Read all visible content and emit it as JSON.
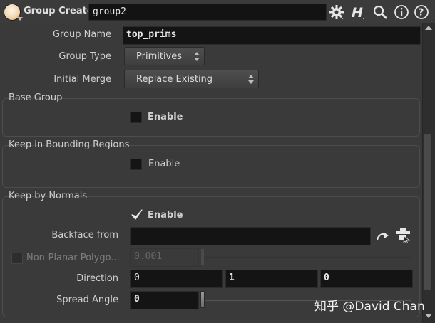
{
  "header": {
    "node_type": "Group Create",
    "node_name": "group2",
    "icons": [
      "node-type-icon",
      "gear-icon",
      "help-h-icon",
      "search-icon",
      "info-icon",
      "help-icon"
    ]
  },
  "params": {
    "group_name": {
      "label": "Group Name",
      "value": "top_prims"
    },
    "group_type": {
      "label": "Group Type",
      "value": "Primitives"
    },
    "initial_merge": {
      "label": "Initial Merge",
      "value": "Replace Existing"
    }
  },
  "base_group": {
    "title": "Base Group",
    "enable_label": "Enable",
    "enabled": false
  },
  "keep_bounding": {
    "title": "Keep in Bounding Regions",
    "enable_label": "Enable",
    "enabled": false
  },
  "keep_normals": {
    "title": "Keep by Normals",
    "enable_label": "Enable",
    "enabled": true,
    "backface_label": "Backface from",
    "backface_value": "",
    "nonplanar_label": "Non-Planar Polygo...",
    "nonplanar_value": "0.001",
    "direction_label": "Direction",
    "direction": [
      "0",
      "1",
      "0"
    ],
    "spread_label": "Spread Angle",
    "spread_value": "0"
  },
  "watermark": "知乎 @David Chan",
  "colors": {
    "background": "#3a3a3a",
    "field_bg": "#141414",
    "text": "#d6d6d6"
  }
}
